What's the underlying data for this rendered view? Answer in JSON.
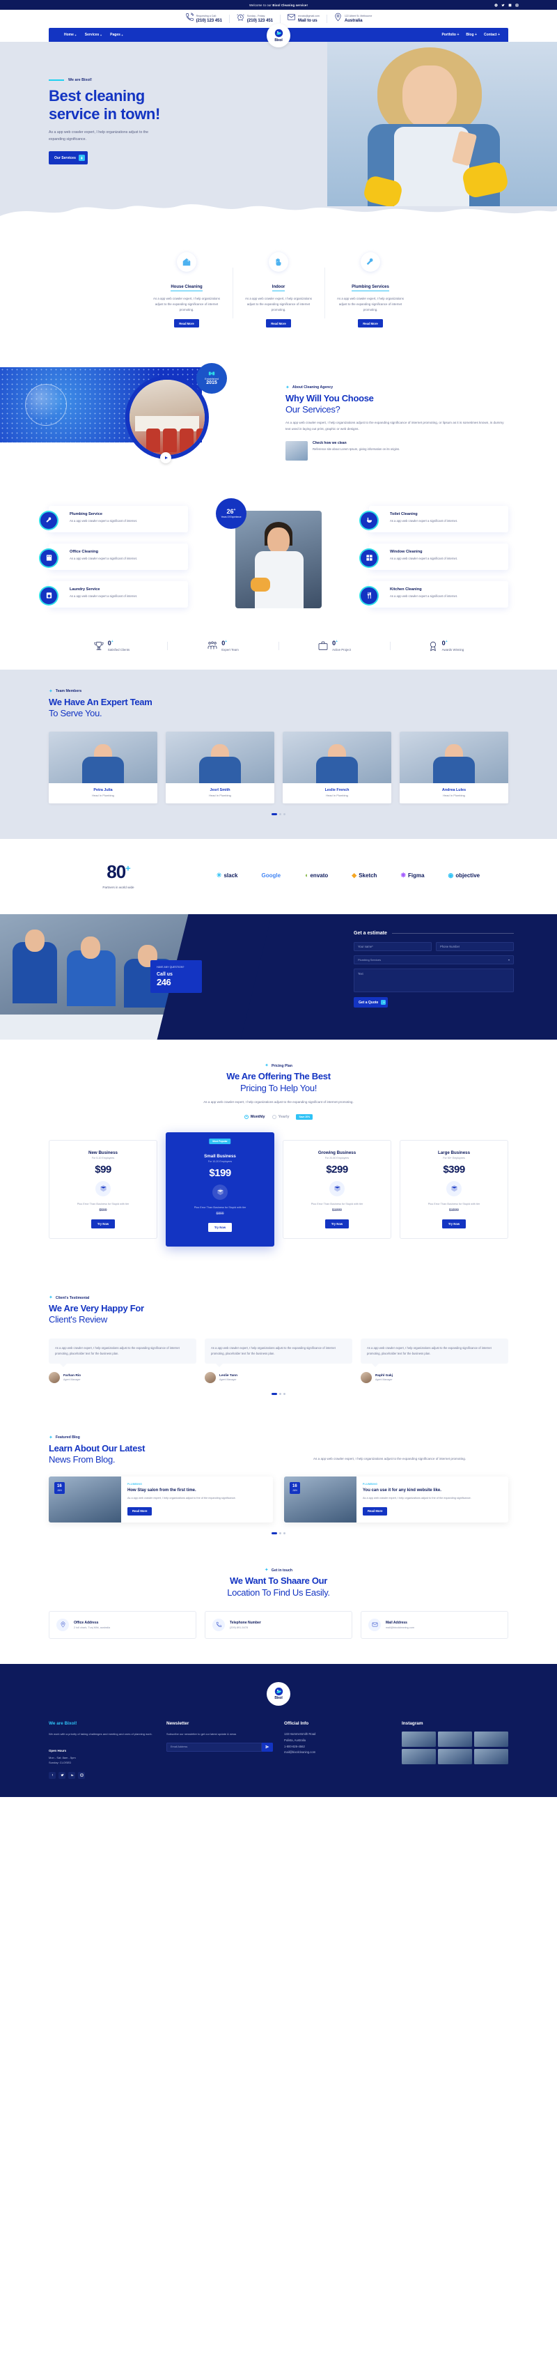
{
  "topbar": {
    "welcome_prefix": "Welcome to our ",
    "welcome_brand": "Bixol Cleaning service!",
    "socials": [
      "facebook-icon",
      "twitter-icon",
      "linkedin-icon",
      "instagram-icon"
    ]
  },
  "infobar": [
    {
      "icon": "phone-call-icon",
      "label": "Requesting a Call:",
      "value": "(210) 123 451"
    },
    {
      "icon": "alarm-clock-icon",
      "label": "Sunday - Friday:",
      "value": "(210) 123 451"
    },
    {
      "icon": "envelope-icon",
      "label": "envato@gmail.com",
      "value": "Mail to us"
    },
    {
      "icon": "map-pin-icon",
      "label": "122 Albert St. Melbourne",
      "value": "Australia"
    }
  ],
  "brand": {
    "name": "Bixol"
  },
  "nav": {
    "left": [
      {
        "label": "Home",
        "caret": "+"
      },
      {
        "label": "Services",
        "caret": "+"
      },
      {
        "label": "Pages",
        "caret": "+"
      }
    ],
    "right": [
      {
        "label": "Portfolio",
        "caret": "+"
      },
      {
        "label": "Blog",
        "caret": "+"
      },
      {
        "label": "Contact",
        "caret": "+"
      }
    ]
  },
  "hero": {
    "eyebrow": "We are Bixol!",
    "title_line1": "Best cleaning",
    "title_line2": "service in town!",
    "paragraph": "As a app web crawler expert, I help organizations adjust to the expanding significance.",
    "cta": "Our Services"
  },
  "services": [
    {
      "icon": "sparkling-house-icon",
      "title": "House Cleaning",
      "text": "As a app web crawler expert, I help organizations adjust to the expanding significance of internet promoting.",
      "button": "Read More"
    },
    {
      "icon": "hand-wipe-icon",
      "title": "Indoor",
      "text": "As a app web crawler expert, I help organizations adjust to the expanding significance of internet promoting.",
      "button": "Read More"
    },
    {
      "icon": "plumbing-tools-icon",
      "title": "Plumbing Services",
      "text": "As a app web crawler expert, I help organizations adjust to the expanding significance of internet promoting.",
      "button": "Read More"
    }
  ],
  "why": {
    "established_label": "Established",
    "established_year": "2015",
    "eyebrow": "About Cleaning Agency",
    "title_line1": "Why Will You Choose",
    "title_line2": "Our Services?",
    "paragraph": "As a app web crawler expert, I help organizations adjust to the expanding significance of internet promoting, or lipsum as it is sometimes known, is dummy text used in laying out print, graphic or web designs.",
    "cta_title": "Check how we clean",
    "cta_text": "Reference site about Lorem Ipsum, giving information on its origins."
  },
  "features": {
    "left": [
      {
        "icon": "plumbing-icon",
        "title": "Plumbing Service",
        "text": "As a app web crawler expert a significant of internet."
      },
      {
        "icon": "office-icon",
        "title": "Office Cleaning",
        "text": "As a app web crawler expert a significant of internet."
      },
      {
        "icon": "laundry-icon",
        "title": "Laundry Service",
        "text": "As a app web crawler expert a significant of internet."
      }
    ],
    "right": [
      {
        "icon": "toilet-icon",
        "title": "Toilet Cleaning",
        "text": "As a app web crawler expert a significant of internet."
      },
      {
        "icon": "window-icon",
        "title": "Window Cleaning",
        "text": "As a app web crawler expert a significant of internet."
      },
      {
        "icon": "kitchen-icon",
        "title": "Kitchen Cleaning",
        "text": "As a app web crawler expert a significant of internet."
      }
    ],
    "badge_number": "26",
    "badge_sup": "+",
    "badge_text": "Years Of Experience"
  },
  "counters": [
    {
      "icon": "trophy-icon",
      "value": "0",
      "sup": "+",
      "label": "Satisfied Clients"
    },
    {
      "icon": "team-icon",
      "value": "0",
      "sup": "+",
      "label": "Expert Team"
    },
    {
      "icon": "project-icon",
      "value": "0",
      "sup": "+",
      "label": "Active Project"
    },
    {
      "icon": "award-icon",
      "value": "0",
      "sup": "+",
      "label": "Awards Winning"
    }
  ],
  "team": {
    "eyebrow": "Team Members",
    "title_line1": "We Have An Expert Team",
    "title_line2": "To Serve You.",
    "members": [
      {
        "name": "Petra Julia",
        "role": "Head In Plumbing"
      },
      {
        "name": "Jesrl Smith",
        "role": "Head In Plumbing"
      },
      {
        "name": "Leslie French",
        "role": "Head In Plumbing"
      },
      {
        "name": "Andrea Lules",
        "role": "Head In Plumbing"
      }
    ]
  },
  "partners": {
    "number": "80",
    "sup": "+",
    "caption": "Partners in world wide",
    "brands": [
      "slack",
      "Google",
      "envato",
      "Sketch",
      "Figma",
      "objective"
    ]
  },
  "estimate": {
    "call_small": "HAVE ANY QUESTION?",
    "call_label": "Call us",
    "call_number": "246",
    "title": "Get a estimate",
    "fields": {
      "first_name": "Your name*",
      "phone": "Phone Number",
      "service": "Plumbing Services",
      "message": "Text"
    },
    "button": "Get a Quote"
  },
  "pricing": {
    "eyebrow": "Pricing Plan",
    "title_line1": "We Are Offering The Best",
    "title_line2": "Pricing To Help You!",
    "subtitle": "As a app web crawler expert, I help organizations adjust to the expanding significant of internet promoting.",
    "toggle_monthly": "Monthly",
    "toggle_yearly": "Yearly",
    "save_badge": "Save 20%",
    "plans": [
      {
        "ribbon": "",
        "name": "New Business",
        "label": "For 5-10 Employees",
        "price": "$99",
        "icon": "package-icon",
        "text": "Plus Error Than Business\nfor Stupid with tier",
        "old": "$500",
        "button": "Try Now"
      },
      {
        "ribbon": "Most Popular",
        "name": "Small Business",
        "label": "For 10-20 Employees",
        "price": "$199",
        "icon": "package-icon",
        "text": "Plus Error Than Business\nfor Stupid with tier",
        "old": "$800",
        "button": "Try Now"
      },
      {
        "ribbon": "",
        "name": "Growing Business",
        "label": "For 20-50 Employees",
        "price": "$299",
        "icon": "package-icon",
        "text": "Plus Error Than Business\nfor Stupid with tier",
        "old": "$1000",
        "button": "Try Now"
      },
      {
        "ribbon": "",
        "name": "Large Business",
        "label": "For 50+ Employees",
        "price": "$399",
        "icon": "package-icon",
        "text": "Plus Error Than Business\nfor Stupid with tier",
        "old": "$1500",
        "button": "Try Now"
      }
    ]
  },
  "testimonials": {
    "eyebrow": "Client's Testimonial",
    "title_line1": "We Are Very Happy For",
    "title_line2": "Client's Review",
    "items": [
      {
        "quote": "As a app web crawler expert, I help organizations adjust to the expanding significance of internet promoting, placeholder text for the business plan.",
        "name": "Farhan Rio",
        "role": "Agent Manager"
      },
      {
        "quote": "As a app web crawler expert, I help organizations adjust to the expanding significance of internet promoting, placeholder text for the business plan.",
        "name": "Leslie Tann",
        "role": "Agent Manager"
      },
      {
        "quote": "As a app web crawler expert, I help organizations adjust to the expanding significance of internet promoting, placeholder text for the business plan.",
        "name": "Raphl Gakj",
        "role": "Agent Manager"
      }
    ]
  },
  "blog": {
    "eyebrow": "Featured Blog",
    "title_line1": "Learn About Our Latest",
    "title_line2": "News From Blog.",
    "right_text": "As a app web crawler expert, I help organizations adjust to the expanding significance of internet promoting.",
    "posts": [
      {
        "day": "16",
        "month": "JUN",
        "tag": "PLUMBING",
        "title": "How Stay salon from the first time.",
        "text": "As a app web crawler expert, I help organizations adjust to the of the expanding significance.",
        "button": "Read More"
      },
      {
        "day": "16",
        "month": "JUN",
        "tag": "PLUMBING",
        "title": "You can use it for any kind website like.",
        "text": "As a app web crawler expert, I help organizations adjust to the of the expanding significance.",
        "button": "Read More"
      }
    ]
  },
  "location": {
    "eyebrow": "Get in touch",
    "title_line1": "We Want To Shaare Our",
    "title_line2": "Location To Find Us Easily.",
    "cards": [
      {
        "icon": "map-pin-icon",
        "title": "Office Address",
        "text": "2 toll chark, Tunj Mlbi, australia"
      },
      {
        "icon": "phone-icon",
        "title": "Telephone Number",
        "text": "(209) 891-5478"
      },
      {
        "icon": "mail-icon",
        "title": "Mail Address",
        "text": "mail@bixolcleaning.com"
      }
    ]
  },
  "footer": {
    "about": {
      "title_prefix": "We are ",
      "title_brand": "Bixol!",
      "text": "We work with a priority of taking challenges and meeting and ones of planning work.",
      "hours_label": "Open Hours",
      "hours_1": "Mon - Sat: 8am - 5pm",
      "hours_2": "Sunday: CLOSED"
    },
    "newsletter": {
      "title": "Newsletter",
      "text": "Subscribe our newsletter to get our latest update & news",
      "placeholder": "Email Address"
    },
    "official": {
      "title": "Official Info",
      "items": [
        "133 Hammersmith Road",
        "Pulista, Australia",
        "1-800-826-4562",
        "mail@bixolcleaning.com"
      ]
    },
    "instagram": {
      "title": "Instagram"
    },
    "socials": [
      "facebook-icon",
      "twitter-icon",
      "linkedin-icon",
      "instagram-icon"
    ]
  }
}
